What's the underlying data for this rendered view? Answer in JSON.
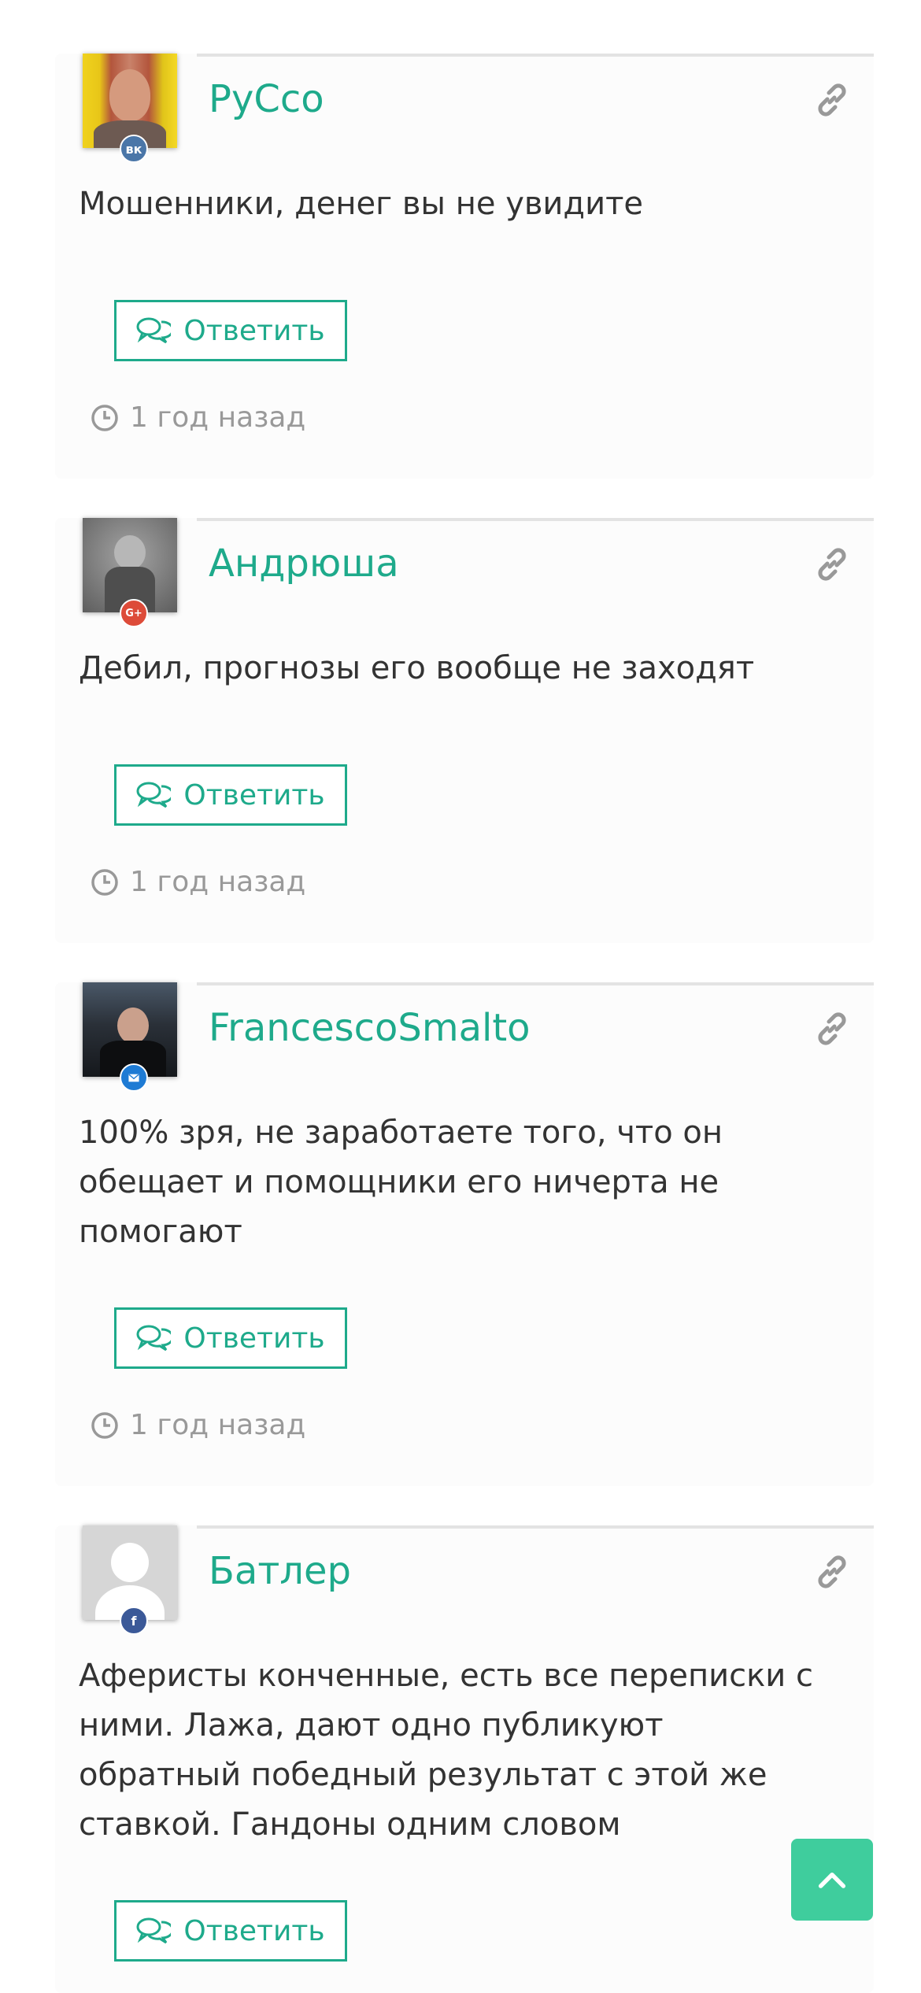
{
  "comments": [
    {
      "author": "РуСсо",
      "network": "vk",
      "network_label": "вк",
      "text": "Мошенники, денег вы не увидите",
      "reply_label": "Ответить",
      "time": "1 год назад"
    },
    {
      "author": "Андрюша",
      "network": "google-plus",
      "network_label": "G+",
      "text": "Дебил, прогнозы его вообще не заходят",
      "reply_label": "Ответить",
      "time": "1 год назад"
    },
    {
      "author": "FrancescoSmalto",
      "network": "email",
      "network_label": "",
      "text": "100% зря, не заработаете того, что он обещает и помощники его ничерта не помогают",
      "reply_label": "Ответить",
      "time": "1 год назад"
    },
    {
      "author": "Батлер",
      "network": "facebook",
      "network_label": "f",
      "text": "Аферисты конченные, есть все переписки с ними. Лажа, дают одно публикуют обратный победный результат с этой же ставкой. Гандоны одним словом",
      "reply_label": "Ответить"
    }
  ],
  "colors": {
    "accent": "#1eaa8b",
    "scroll_top_bg": "#3fcd9d",
    "vk": "#4a76a8",
    "google_plus": "#dd4b39",
    "email": "#1e7bd4",
    "facebook": "#3b5998"
  },
  "icons": {
    "link": "link-icon",
    "reply": "chat-bubbles-icon",
    "time": "clock-icon",
    "scroll_top": "chevron-up-icon"
  }
}
